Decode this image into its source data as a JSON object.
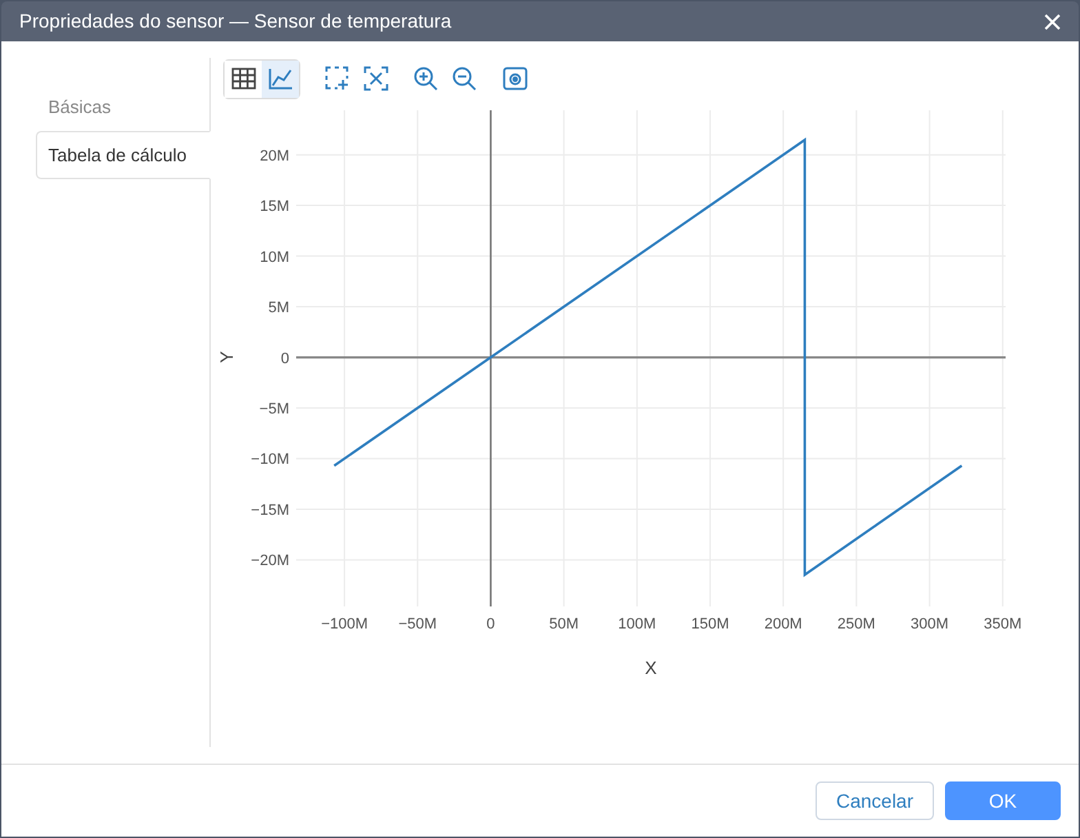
{
  "window": {
    "title": "Propriedades do sensor — Sensor de temperatura"
  },
  "tabs": [
    {
      "label": "Básicas",
      "selected": false
    },
    {
      "label": "Tabela de cálculo",
      "selected": true
    }
  ],
  "view_toggle": [
    {
      "kind": "table",
      "selected": false
    },
    {
      "kind": "chart",
      "selected": true
    }
  ],
  "chart": {
    "chart_data": {
      "type": "line",
      "xlabel": "X",
      "ylabel": "Y",
      "x": [
        -107000000,
        0,
        214700000,
        214700000,
        322000000
      ],
      "grid": true,
      "series": [
        {
          "color": "#2e7ebf",
          "values": [
            -10700000,
            0,
            21470000,
            -21470000,
            -10700000
          ]
        }
      ],
      "xlim": [
        -133000000,
        352000000
      ],
      "ylim": [
        -24600000,
        24400000
      ],
      "xticks": [
        {
          "value": -100000000,
          "label": "−100M"
        },
        {
          "value": -50000000,
          "label": "−50M"
        },
        {
          "value": 0,
          "label": "0"
        },
        {
          "value": 50000000,
          "label": "50M"
        },
        {
          "value": 100000000,
          "label": "100M"
        },
        {
          "value": 150000000,
          "label": "150M"
        },
        {
          "value": 200000000,
          "label": "200M"
        },
        {
          "value": 250000000,
          "label": "250M"
        },
        {
          "value": 300000000,
          "label": "300M"
        },
        {
          "value": 350000000,
          "label": "350M"
        }
      ],
      "yticks": [
        {
          "value": 20000000,
          "label": "20M"
        },
        {
          "value": 15000000,
          "label": "15M"
        },
        {
          "value": 10000000,
          "label": "10M"
        },
        {
          "value": 5000000,
          "label": "5M"
        },
        {
          "value": 0,
          "label": "0"
        },
        {
          "value": -5000000,
          "label": "−5M"
        },
        {
          "value": -10000000,
          "label": "−10M"
        },
        {
          "value": -15000000,
          "label": "−15M"
        },
        {
          "value": -20000000,
          "label": "−20M"
        }
      ]
    }
  },
  "buttons": [
    {
      "label": "Cancelar",
      "kind": "secondary"
    },
    {
      "label": "OK",
      "kind": "primary"
    }
  ]
}
